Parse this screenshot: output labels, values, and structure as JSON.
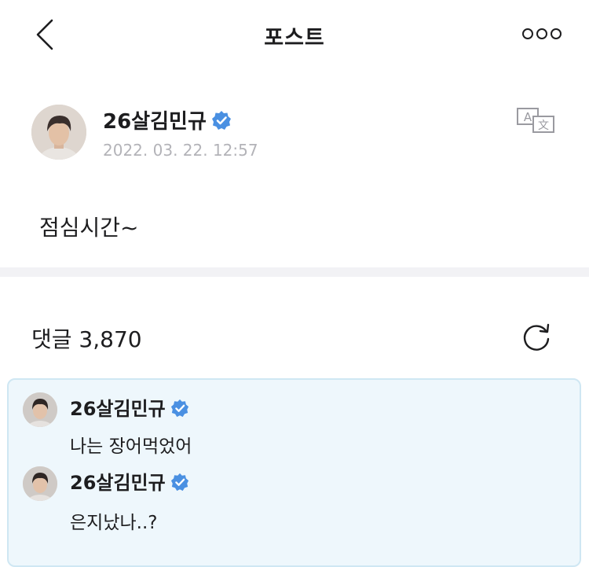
{
  "header": {
    "title": "포스트",
    "back_icon": "chevron-left-icon",
    "more_icon": "more-dots-icon"
  },
  "post": {
    "author": "26살김민규",
    "verified_icon": "verified-badge-icon",
    "timestamp": "2022. 03. 22. 12:57",
    "translate_icon": "translate-icon",
    "body": "점심시간~"
  },
  "comments": {
    "label": "댓글 3,870",
    "refresh_icon": "refresh-icon",
    "items": [
      {
        "author": "26살김민규",
        "text": "나는 장어먹었어"
      },
      {
        "author": "26살김민규",
        "text": "은지났나..?"
      }
    ]
  },
  "colors": {
    "verified": "#4a90e2",
    "timestamp": "#b3b3b8",
    "highlight_bg": "#eef7fc",
    "highlight_border": "#cfe7f3"
  }
}
